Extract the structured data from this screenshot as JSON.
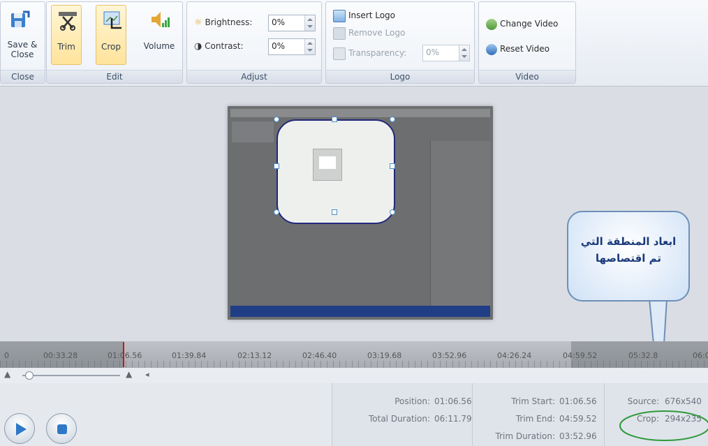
{
  "ribbon": {
    "close_group": {
      "title": "Close",
      "save_close_label": "Save & Close"
    },
    "edit_group": {
      "title": "Edit",
      "trim_label": "Trim",
      "crop_label": "Crop",
      "volume_label": "Volume"
    },
    "adjust_group": {
      "title": "Adjust",
      "brightness_label": "Brightness:",
      "brightness_value": "0%",
      "contrast_label": "Contrast:",
      "contrast_value": "0%"
    },
    "logo_group": {
      "title": "Logo",
      "insert_logo_label": "Insert Logo",
      "remove_logo_label": "Remove Logo",
      "transparency_label": "Transparency:",
      "transparency_value": "0%"
    },
    "video_group": {
      "title": "Video",
      "change_video_label": "Change Video",
      "reset_video_label": "Reset Video"
    }
  },
  "callout": {
    "line1": "ابعاد المنطقة التي",
    "line2": "تم اقتصاصها"
  },
  "timeline": {
    "ticks": [
      "0",
      "00:33.28",
      "01:06.56",
      "01:39.84",
      "02:13.12",
      "02:46.40",
      "03:19.68",
      "03:52.96",
      "04:26.24",
      "04:59.52",
      "05:32.8",
      "06:0"
    ]
  },
  "status": {
    "position_label": "Position:",
    "position_value": "01:06.56",
    "total_duration_label": "Total Duration:",
    "total_duration_value": "06:11.79",
    "trim_start_label": "Trim Start:",
    "trim_start_value": "01:06.56",
    "trim_end_label": "Trim End:",
    "trim_end_value": "04:59.52",
    "trim_duration_label": "Trim Duration:",
    "trim_duration_value": "03:52.96",
    "source_label": "Source:",
    "source_value": "676x540",
    "crop_label": "Crop:",
    "crop_value": "294x235"
  },
  "colors": {
    "accent_active": "#ffe39b",
    "crop_border": "#24287a",
    "playhead": "#d2111b",
    "callout_border": "#6d8fb7",
    "ellipse": "#2f9a3a"
  }
}
